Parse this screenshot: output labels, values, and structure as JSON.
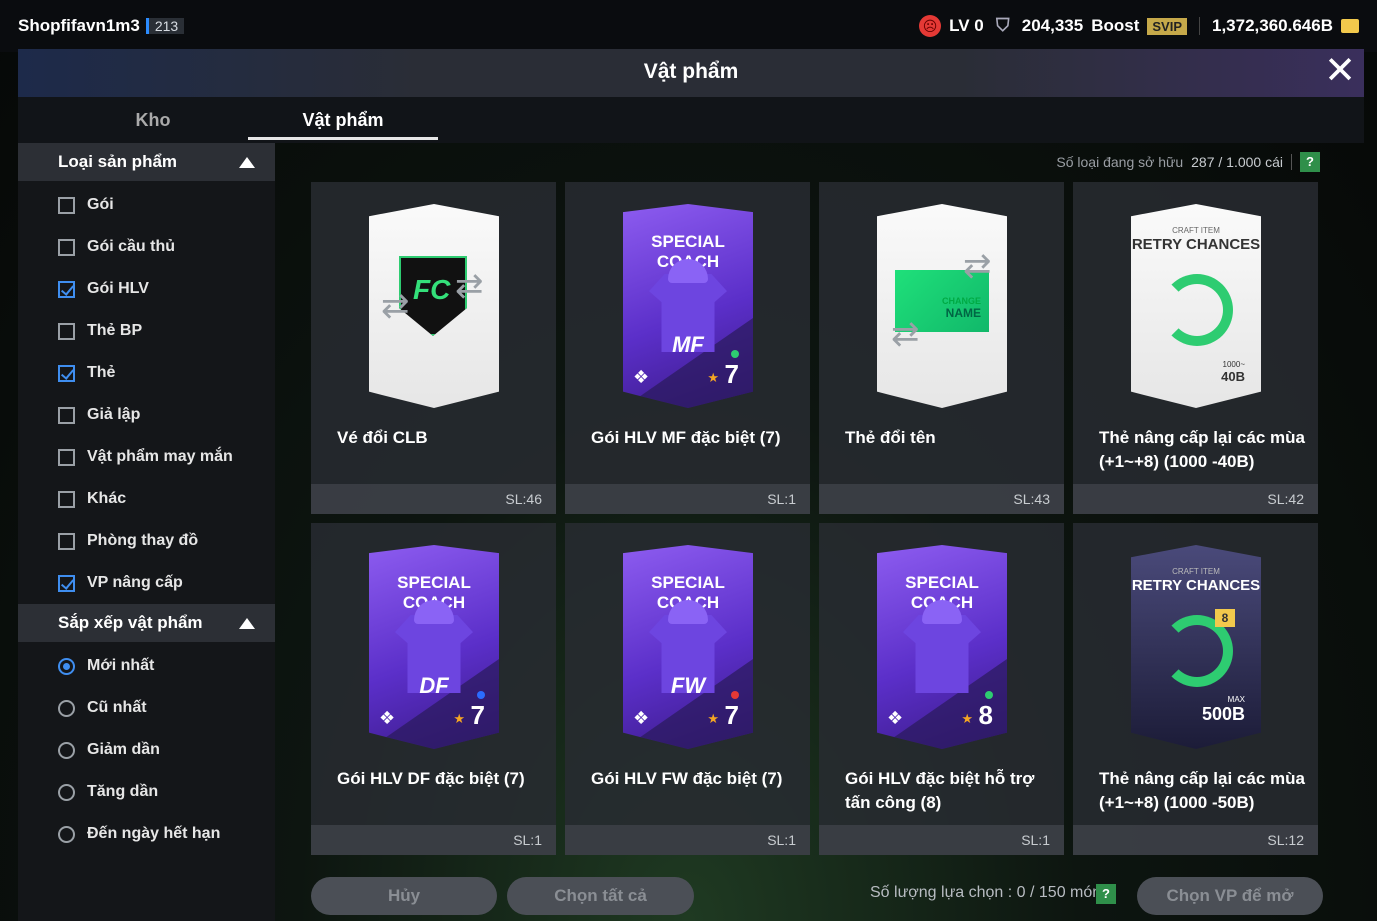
{
  "topbar": {
    "username": "Shopfifavn1m3",
    "user_level": "213",
    "lv": "LV 0",
    "currency": "204,335",
    "boost": "Boost",
    "svip": "SVIP",
    "bp": "1,372,360.646B"
  },
  "header": {
    "title": "Vật phẩm",
    "close_icon": "close-icon"
  },
  "tabs": [
    {
      "label": "Kho"
    },
    {
      "label": "Vật phẩm"
    }
  ],
  "sidebar": {
    "filter_title": "Loại sản phẩm",
    "filters": [
      {
        "label": "Gói",
        "checked": false
      },
      {
        "label": "Gói cầu thủ",
        "checked": false
      },
      {
        "label": "Gói HLV",
        "checked": true
      },
      {
        "label": "Thẻ BP",
        "checked": false
      },
      {
        "label": "Thẻ",
        "checked": true
      },
      {
        "label": "Giả lập",
        "checked": false
      },
      {
        "label": "Vật phẩm may mắn",
        "checked": false
      },
      {
        "label": "Khác",
        "checked": false
      },
      {
        "label": "Phòng thay đồ",
        "checked": false
      },
      {
        "label": "VP nâng cấp",
        "checked": true
      }
    ],
    "sort_title": "Sắp xếp vật phẩm",
    "sorts": [
      {
        "label": "Mới nhất",
        "selected": true
      },
      {
        "label": "Cũ nhất",
        "selected": false
      },
      {
        "label": "Giảm dần",
        "selected": false
      },
      {
        "label": "Tăng dần",
        "selected": false
      },
      {
        "label": "Đến ngày hết hạn",
        "selected": false
      }
    ]
  },
  "count": {
    "label": "Số loại đang sở hữu",
    "value": "287 / 1.000 cái",
    "help": "?"
  },
  "items": [
    {
      "name": "Vé đổi CLB",
      "qty": "SL:46",
      "art": "club"
    },
    {
      "name": "Gói HLV MF đặc biệt (7)",
      "qty": "SL:1",
      "art": "coach",
      "card_title": "SPECIAL COACH",
      "pos": "MF",
      "ovr": "7",
      "dot": "#2ecc71"
    },
    {
      "name": "Thẻ đổi tên",
      "qty": "SL:43",
      "art": "rename",
      "t1": "CHANGE",
      "t2": "NAME"
    },
    {
      "name": "Thẻ nâng cấp lại các mùa (+1~+8) (1000 -40B)",
      "qty": "SL:42",
      "art": "craft",
      "craft_top": "CRAFT ITEM",
      "craft_title": "RETRY CHANCES",
      "tag_small": "1000~",
      "tag": "40B"
    },
    {
      "name": "Gói HLV DF đặc biệt (7)",
      "qty": "SL:1",
      "art": "coach",
      "card_title": "SPECIAL COACH",
      "pos": "DF",
      "ovr": "7",
      "dot": "#2b6cff"
    },
    {
      "name": "Gói HLV FW đặc biệt (7)",
      "qty": "SL:1",
      "art": "coach",
      "card_title": "SPECIAL COACH",
      "pos": "FW",
      "ovr": "7",
      "dot": "#e53935"
    },
    {
      "name": "Gói HLV đặc biệt hỗ trợ tấn công (8)",
      "qty": "SL:1",
      "art": "coach",
      "card_title": "SPECIAL COACH",
      "pos": "",
      "ovr": "8",
      "dot": "#2ecc71"
    },
    {
      "name": "Thẻ nâng cấp lại các mùa (+1~+8) (1000 -50B)",
      "qty": "SL:12",
      "art": "craftdark",
      "craft_top": "CRAFT ITEM",
      "craft_title": "RETRY CHANCES",
      "badge": "8",
      "tag_small": "MAX",
      "tag": "500B"
    }
  ],
  "bottom": {
    "cancel": "Hủy",
    "select_all": "Chọn tất cả",
    "selected_count": "Số lượng lựa chọn : 0 / 150 món",
    "help": "?",
    "open": "Chọn VP để mở"
  }
}
